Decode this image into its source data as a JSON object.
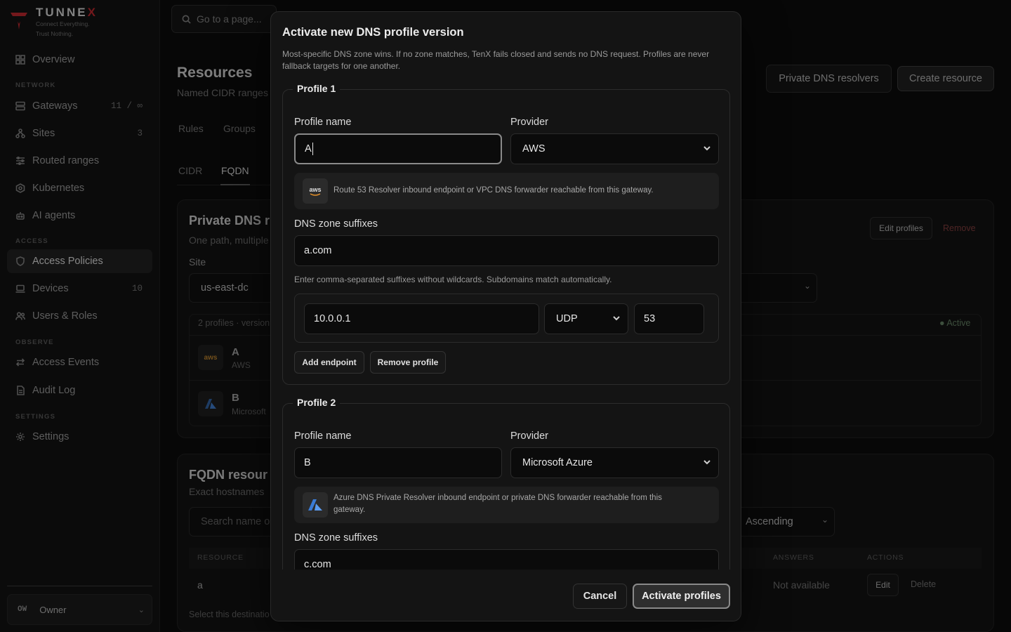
{
  "brand": {
    "name_main": "TUNNE",
    "name_x": "X",
    "tagline_1": "Connect Everything.",
    "tagline_2": "Trust Nothing.",
    "accent": "#b3262c"
  },
  "sidebar": {
    "overview": "Overview",
    "sections": {
      "network": "NETWORK",
      "access": "ACCESS",
      "observe": "OBSERVE",
      "settings": "SETTINGS"
    },
    "items": [
      {
        "label": "Gateways",
        "count": "11 / ∞",
        "icon": "server-icon"
      },
      {
        "label": "Sites",
        "count": "3",
        "icon": "sites-icon"
      },
      {
        "label": "Routed ranges",
        "icon": "routes-icon"
      },
      {
        "label": "Kubernetes",
        "icon": "kubernetes-icon"
      },
      {
        "label": "AI agents",
        "icon": "bot-icon"
      },
      {
        "label": "Access Policies",
        "icon": "shield-icon"
      },
      {
        "label": "Devices",
        "count": "10",
        "icon": "laptop-icon"
      },
      {
        "label": "Users & Roles",
        "icon": "users-icon"
      },
      {
        "label": "Access Events",
        "icon": "arrows-icon"
      },
      {
        "label": "Audit Log",
        "icon": "document-icon"
      },
      {
        "label": "Settings",
        "icon": "gear-icon"
      }
    ],
    "owner": {
      "initials": "OW",
      "label": "Owner"
    }
  },
  "search": {
    "placeholder": "Go to a page..."
  },
  "page": {
    "title": "Resources",
    "subtitle": "Named CIDR ranges",
    "btn_resolvers": "Private DNS resolvers",
    "btn_create": "Create resource",
    "tabs": [
      "Rules",
      "Groups"
    ],
    "subtabs": [
      "CIDR",
      "FQDN"
    ]
  },
  "dns_card": {
    "title": "Private DNS r",
    "subtitle": "One path, multiple",
    "site_label": "Site",
    "site_value": "us-east-dc",
    "edit_profiles": "Edit profiles",
    "remove": "Remove",
    "profiles_meta": "2 profiles · version",
    "status": "Active",
    "profiles": [
      {
        "name": "A",
        "provider": "AWS"
      },
      {
        "name": "B",
        "provider": "Microsoft"
      }
    ]
  },
  "fqdn_card": {
    "title": "FQDN resour",
    "subtitle": "Exact hostnames",
    "search_placeholder": "Search name or",
    "sort_value": "Ascending",
    "columns": {
      "resource": "RESOURCE",
      "answers": "ANSWERS",
      "actions": "ACTIONS"
    },
    "row": {
      "resource": "a",
      "answers": "Not available",
      "edit": "Edit",
      "delete": "Delete"
    },
    "footer_text": "Select this destinatio"
  },
  "modal": {
    "title": "Activate new DNS profile version",
    "description": "Most-specific DNS zone wins. If no zone matches, TenX fails closed and sends no DNS request. Profiles are never fallback targets for one another.",
    "labels": {
      "profile_name": "Profile name",
      "provider": "Provider",
      "zone_suffixes": "DNS zone suffixes"
    },
    "zone_help": "Enter comma-separated suffixes without wildcards. Subdomains match automatically.",
    "profile1": {
      "legend": "Profile 1",
      "name": "A",
      "provider": "AWS",
      "hint": "Route 53 Resolver inbound endpoint or VPC DNS forwarder reachable from this gateway.",
      "zones": "a.com",
      "endpoint": {
        "ip": "10.0.0.1",
        "protocol": "UDP",
        "port": "53"
      },
      "add_endpoint": "Add endpoint",
      "remove_profile": "Remove profile"
    },
    "profile2": {
      "legend": "Profile 2",
      "name": "B",
      "provider": "Microsoft Azure",
      "hint_line1": "Azure DNS Private Resolver inbound endpoint or private DNS forwarder reachable from this",
      "hint_line2": "gateway.",
      "zones": "c.com"
    },
    "cancel": "Cancel",
    "activate": "Activate profiles"
  }
}
